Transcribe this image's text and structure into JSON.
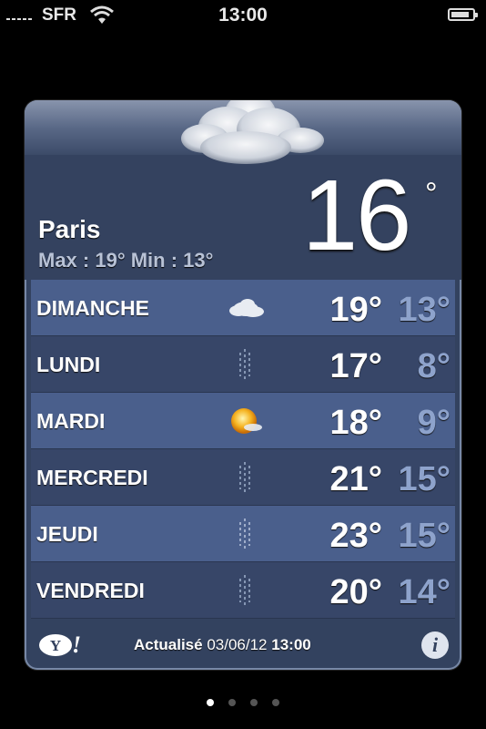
{
  "status_bar": {
    "carrier": "SFR",
    "time": "13:00",
    "signal_bars": 5,
    "battery_level": 0.85,
    "icons": [
      "signal-icon",
      "wifi-icon",
      "battery-icon"
    ]
  },
  "weather": {
    "city": "Paris",
    "hilo": "Max : 19° Min : 13°",
    "current_temp": "16",
    "degree_symbol": "°",
    "current_icon": "cloud-icon",
    "forecast": [
      {
        "day": "DIMANCHE",
        "icon": "cloud-icon",
        "high": "19°",
        "low": "13°"
      },
      {
        "day": "LUNDI",
        "icon": "rain-icon",
        "high": "17°",
        "low": "8°"
      },
      {
        "day": "MARDI",
        "icon": "sun-cloud-icon",
        "high": "18°",
        "low": "9°"
      },
      {
        "day": "MERCREDI",
        "icon": "rain-icon",
        "high": "21°",
        "low": "15°"
      },
      {
        "day": "JEUDI",
        "icon": "rain-icon",
        "high": "23°",
        "low": "15°"
      },
      {
        "day": "VENDREDI",
        "icon": "rain-icon",
        "high": "20°",
        "low": "14°"
      }
    ]
  },
  "footer": {
    "provider_logo": "Y!",
    "updated_label": "Actualisé",
    "updated_date": "03/06/12",
    "updated_time": "13:00",
    "info_label": "i"
  },
  "pagination": {
    "pages": 4,
    "active": 0
  },
  "colors": {
    "panel": "#33425f",
    "row_light": "#4a5f8c",
    "row_dark": "#374668",
    "low_temp": "#8ea3cc"
  }
}
